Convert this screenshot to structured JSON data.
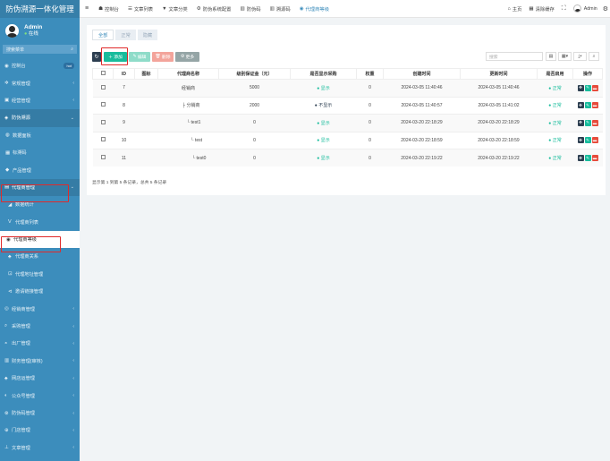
{
  "sidebar": {
    "brand": "防伪溯源一体化管理",
    "user": {
      "name": "Admin",
      "status": "在线"
    },
    "search_placeholder": "搜索菜单",
    "items": [
      {
        "icon": "dashboard-icon",
        "glyph": "◉",
        "label": "控制台",
        "badge": "hot",
        "type": "top",
        "arrow": ""
      },
      {
        "icon": "cogs-icon",
        "glyph": "✲",
        "label": "常规管理",
        "type": "top",
        "arrow": "‹"
      },
      {
        "icon": "wallet-icon",
        "glyph": "▣",
        "label": "经营管理",
        "type": "top",
        "arrow": "‹"
      },
      {
        "icon": "shield-icon",
        "glyph": "◈",
        "label": "防伪溯源",
        "type": "active",
        "arrow": "⌄"
      },
      {
        "icon": "database-icon",
        "glyph": "◍",
        "label": "数据面板",
        "type": "sub",
        "arrow": ""
      },
      {
        "icon": "qrcode-icon",
        "glyph": "▦",
        "label": "标溯码",
        "type": "sub",
        "arrow": ""
      },
      {
        "icon": "product-icon",
        "glyph": "◆",
        "label": "产品管理",
        "type": "sub",
        "arrow": ""
      },
      {
        "icon": "id-card-icon",
        "glyph": "▤",
        "label": "代理商管理",
        "type": "active",
        "arrow": "⌄"
      },
      {
        "icon": "chart-icon",
        "glyph": "◢",
        "label": "数据统计",
        "type": "sub2",
        "arrow": ""
      },
      {
        "icon": "vip-icon",
        "glyph": "V",
        "label": "代理商列表",
        "type": "sub2",
        "arrow": ""
      },
      {
        "icon": "level-icon",
        "glyph": "◉",
        "label": "代理商等级",
        "type": "current",
        "arrow": ""
      },
      {
        "icon": "sitemap-icon",
        "glyph": "♣",
        "label": "代理商关系",
        "type": "sub2",
        "arrow": ""
      },
      {
        "icon": "lock-icon",
        "glyph": "⊡",
        "label": "代理地址管理",
        "type": "sub2",
        "arrow": ""
      },
      {
        "icon": "share-icon",
        "glyph": "⊲",
        "label": "邀请链接管理",
        "type": "sub2",
        "arrow": ""
      },
      {
        "icon": "purchase-icon",
        "glyph": "◎",
        "label": "经销商管理",
        "type": "top",
        "arrow": "‹"
      },
      {
        "icon": "search-icon",
        "glyph": "⌕",
        "label": "采购管理",
        "type": "top",
        "arrow": "‹"
      },
      {
        "icon": "factory-icon",
        "glyph": "◓",
        "label": "出厂管理",
        "type": "top",
        "arrow": "‹"
      },
      {
        "icon": "finance-icon",
        "glyph": "▥",
        "label": "财务管理(审核)",
        "type": "top",
        "arrow": "‹"
      },
      {
        "icon": "network-icon",
        "glyph": "♣",
        "label": "网店运管理",
        "type": "top",
        "arrow": "‹"
      },
      {
        "icon": "wechat-icon",
        "glyph": "◐",
        "label": "公众号管理",
        "type": "top",
        "arrow": "‹"
      },
      {
        "icon": "fake-icon",
        "glyph": "⊗",
        "label": "防伪码管理",
        "type": "top",
        "arrow": "‹"
      },
      {
        "icon": "store-icon",
        "glyph": "⊕",
        "label": "门店管理",
        "type": "top",
        "arrow": "‹"
      },
      {
        "icon": "article-icon",
        "glyph": "⊥",
        "label": "文章管理",
        "type": "top",
        "arrow": "‹"
      }
    ]
  },
  "topbar": {
    "tabs": [
      {
        "icon": "dashboard-icon",
        "glyph": "☗",
        "label": "控制台"
      },
      {
        "icon": "list-icon",
        "glyph": "☰",
        "label": "文章列表"
      },
      {
        "icon": "filter-icon",
        "glyph": "▼",
        "label": "文章分类"
      },
      {
        "icon": "gear-icon",
        "glyph": "⚙",
        "label": "防伪系统配置"
      },
      {
        "icon": "barcode-icon",
        "glyph": "▥",
        "label": "防伪码"
      },
      {
        "icon": "trace-icon",
        "glyph": "▥",
        "label": "溯源码"
      },
      {
        "icon": "level-icon",
        "glyph": "◉",
        "label": "代理商等级",
        "active": true
      }
    ],
    "home": "主页",
    "clear_cache": "清除缓存",
    "user": "Admin"
  },
  "panel": {
    "tabs": [
      "全部",
      "正常",
      "隐藏"
    ],
    "toolbar": {
      "add": "添加",
      "edit": "编辑",
      "delete": "删除",
      "more": "更多",
      "search_placeholder": "搜索"
    },
    "columns": [
      "ID",
      "图标",
      "代理商名称",
      "级别保证金（元）",
      "是否显示采购",
      "权重",
      "创建时间",
      "更新时间",
      "是否启用",
      "操作"
    ],
    "rows": [
      {
        "id": "7",
        "name": "经销商",
        "deposit": "5000",
        "show": "显示",
        "show_dot": "green",
        "weight": "0",
        "created": "2024-03-05 11:40:46",
        "updated": "2024-03-05 11:40:46",
        "enabled": "正常",
        "indent": 0
      },
      {
        "id": "8",
        "name": "├ 分销商",
        "deposit": "2000",
        "show": "不显示",
        "show_dot": "dark",
        "weight": "0",
        "created": "2024-03-05 11:40:57",
        "updated": "2024-03-05 11:41:02",
        "enabled": "正常",
        "indent": 1
      },
      {
        "id": "9",
        "name": "└ test1",
        "deposit": "0",
        "show": "显示",
        "show_dot": "green",
        "weight": "0",
        "created": "2024-03-20 22:18:29",
        "updated": "2024-03-20 22:18:29",
        "enabled": "正常",
        "indent": 2
      },
      {
        "id": "10",
        "name": "└ test",
        "deposit": "0",
        "show": "显示",
        "show_dot": "green",
        "weight": "0",
        "created": "2024-03-20 22:18:59",
        "updated": "2024-03-20 22:18:59",
        "enabled": "正常",
        "indent": 3
      },
      {
        "id": "11",
        "name": "└ test0",
        "deposit": "0",
        "show": "显示",
        "show_dot": "green",
        "weight": "0",
        "created": "2024-03-20 22:19:22",
        "updated": "2024-03-20 22:19:22",
        "enabled": "正常",
        "indent": 4
      }
    ],
    "summary": "显示第 1 到第 5 条记录，总共 5 条记录"
  },
  "colors": {
    "sidebar": "#3c8dbc",
    "success": "#18bc9c",
    "danger": "#e74c3c",
    "dark": "#2c3e50",
    "highlight": "#e02b2b"
  }
}
